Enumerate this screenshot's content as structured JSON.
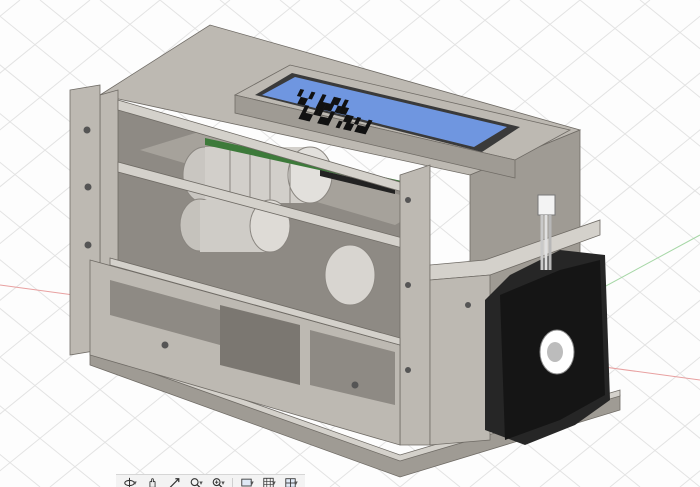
{
  "viewport": {
    "background": "#fdfdfd",
    "grid_color": "#e3e3e3",
    "x_axis_color": "#e8a0a0",
    "z_axis_color": "#a6d7a6"
  },
  "model": {
    "body_color": "#bdb9b2",
    "body_shade": "#9f9b94",
    "body_light": "#d4d1cb",
    "lcd_color": "#6f96e0",
    "lcd_frame": "#3a3a3a",
    "motor_color": "#262626",
    "pcb_color": "#3d7a3a",
    "lcd_rows": [
      "▚▞ ▙▟▚▙",
      "▙▞▚▟ ▞▙▚▟"
    ]
  },
  "toolbar": {
    "icons": [
      {
        "name": "orbit-icon",
        "has_menu": true
      },
      {
        "name": "pan-icon",
        "has_menu": false
      },
      {
        "name": "look-at-icon",
        "has_menu": false
      },
      {
        "name": "zoom-window-icon",
        "has_menu": true
      },
      {
        "name": "fit-icon",
        "has_menu": true
      },
      {
        "name": "display-settings-icon",
        "has_menu": true
      },
      {
        "name": "grid-settings-icon",
        "has_menu": true
      },
      {
        "name": "viewports-icon",
        "has_menu": true
      }
    ],
    "caret": "▾"
  }
}
